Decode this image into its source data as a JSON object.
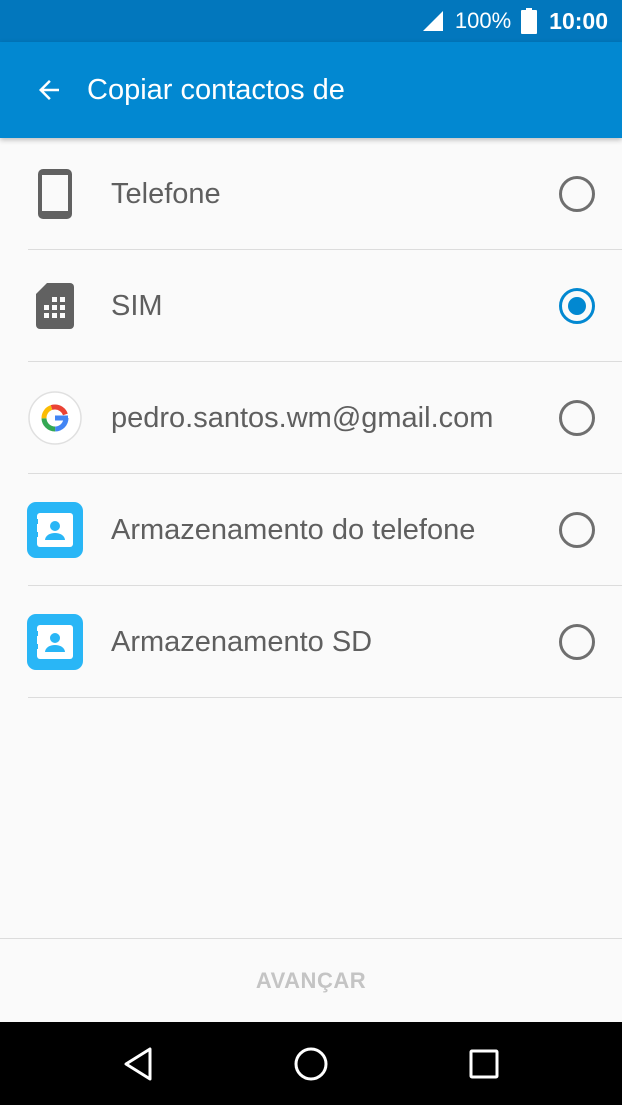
{
  "status_bar": {
    "battery_percent": "100%",
    "time": "10:00"
  },
  "app_bar": {
    "title": "Copiar contactos de",
    "back_icon": "arrow-back-icon"
  },
  "accounts": [
    {
      "label": "Telefone",
      "icon": "phone-icon",
      "selected": false
    },
    {
      "label": "SIM",
      "icon": "sim-card-icon",
      "selected": true
    },
    {
      "label": "pedro.santos.wm@gmail.com",
      "icon": "google-icon",
      "selected": false
    },
    {
      "label": "Armazenamento do telefone",
      "icon": "contacts-storage-icon",
      "selected": false
    },
    {
      "label": "Armazenamento SD",
      "icon": "contacts-storage-icon",
      "selected": false
    }
  ],
  "footer": {
    "next_label": "AVANÇAR",
    "next_enabled": false
  },
  "colors": {
    "primary": "#0288d1",
    "status_bar": "#0277bd",
    "storage_icon": "#29b6f6"
  }
}
